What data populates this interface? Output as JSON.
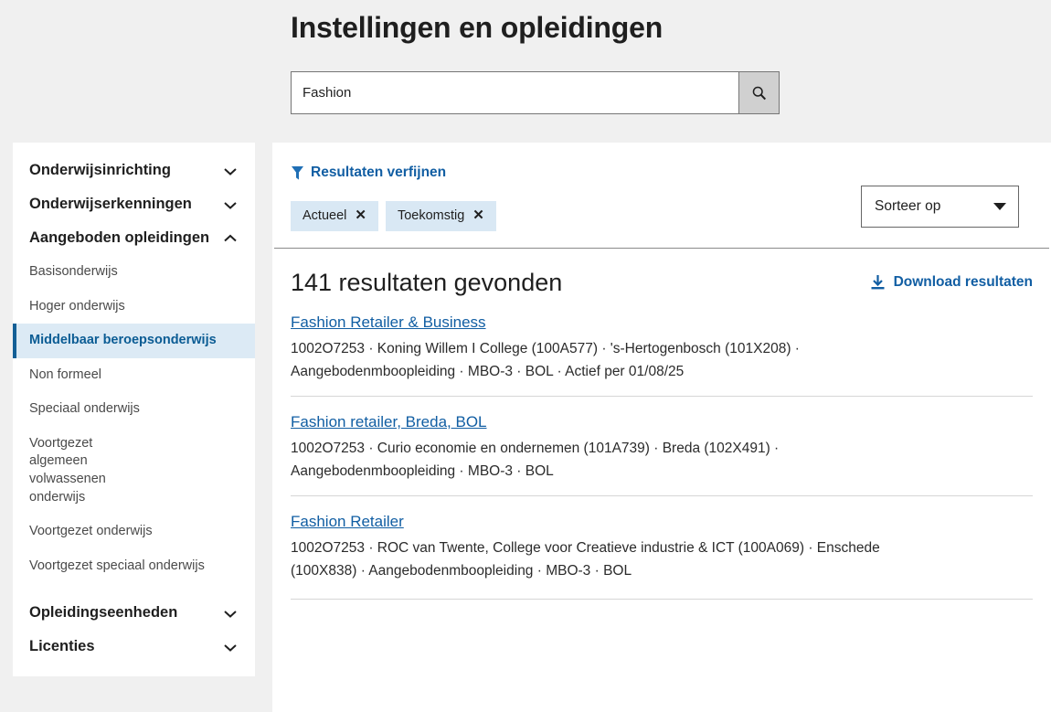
{
  "header": {
    "title": "Instellingen en opleidingen",
    "search": {
      "value": "Fashion",
      "placeholder": "",
      "button_icon": "search-icon"
    }
  },
  "sidebar": {
    "groups": [
      {
        "label": "Onderwijsinrichting",
        "icon": "chevron-down-icon",
        "expanded": false
      },
      {
        "label": "Onderwijserkenningen",
        "icon": "chevron-down-icon",
        "expanded": false
      },
      {
        "label": "Aangeboden opleidingen",
        "icon": "chevron-up-icon",
        "expanded": true
      }
    ],
    "items": [
      {
        "label": "Basisonderwijs",
        "active": false
      },
      {
        "label": "Hoger onderwijs",
        "active": false
      },
      {
        "label": "Middelbaar beroepsonderwijs",
        "active": true
      },
      {
        "label": "Non formeel",
        "active": false
      },
      {
        "label": "Speciaal onderwijs",
        "active": false
      },
      {
        "label": "Voortgezet algemeen volwassenen onderwijs",
        "active": false
      },
      {
        "label": "Voortgezet onderwijs",
        "active": false
      },
      {
        "label": "Voortgezet speciaal onderwijs",
        "active": false
      }
    ],
    "groups_bottom": [
      {
        "label": "Opleidingseenheden",
        "icon": "chevron-down-icon",
        "expanded": false
      },
      {
        "label": "Licenties",
        "icon": "chevron-down-icon",
        "expanded": false
      }
    ]
  },
  "filters": {
    "refine_label": "Resultaten verfijnen",
    "refine_icon": "filter-funnel-icon",
    "chips": [
      {
        "label": "Actueel",
        "remove_icon": "close-icon"
      },
      {
        "label": "Toekomstig",
        "remove_icon": "close-icon"
      }
    ],
    "sort": {
      "label": "Sorteer op",
      "icon": "chevron-down-icon"
    }
  },
  "results": {
    "count_label": "141 resultaten gevonden",
    "download_label": "Download resultaten",
    "download_icon": "download-icon",
    "items": [
      {
        "title": "Fashion Retailer & Business",
        "meta": "1002O7253  ·  Koning Willem I College (100A577)  ·  's-Hertogenbosch (101X208)  ·  Aangebodenmboopleiding  ·  MBO-3  ·  BOL  ·  Actief per 01/08/25"
      },
      {
        "title": "Fashion retailer, Breda, BOL",
        "meta": "1002O7253  ·  Curio economie en ondernemen (101A739)  ·  Breda (102X491)  ·  Aangebodenmboopleiding  ·  MBO-3  ·  BOL"
      },
      {
        "title": "Fashion Retailer",
        "meta": "1002O7253  ·  ROC van Twente, College voor Creatieve industrie & ICT (100A069)  ·  Enschede (100X838)  ·  Aangebodenmboopleiding  ·  MBO-3  ·  BOL"
      }
    ]
  },
  "colors": {
    "page_background": "#f0f0f0",
    "panel": "#ffffff",
    "link_blue": "#115ea3",
    "active_item_bg": "#dceaf5",
    "active_item_text": "#0b5c94",
    "active_item_bar": "#135f96",
    "chip_bg": "#d9e8f4",
    "text": "#1f1f1f"
  }
}
